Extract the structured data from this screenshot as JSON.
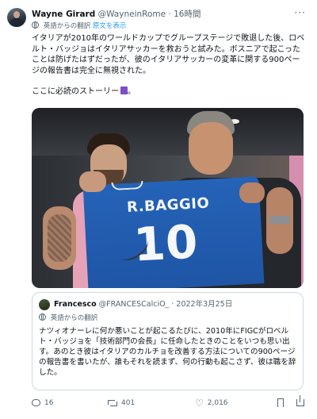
{
  "tweet": {
    "author_name": "Wayne Girard",
    "author_handle": "@WayneinRome",
    "separator": "·",
    "time": "16時間",
    "more_label": "···",
    "translated_from": "英語からの翻訳",
    "show_original": "原文を表示",
    "body_lines": [
      "イタリアが2010年のワールドカップでグループステージで敗退した後、ロベ",
      "ルト・バッジョはイタリアサッカーを救おうと試みた。ボスニアで起こった",
      "ことは防げたはずだったが、彼のイタリアサッカーの変革に関する900ペー",
      "ジの報告書は完全に無視された。"
    ],
    "body_tail": "ここに必読のストーリー",
    "body_tail_suffix": "。"
  },
  "photo": {
    "jersey_name": "R.BAGGIO",
    "jersey_number": "10"
  },
  "quote": {
    "name": "Francesco",
    "handle": "@FRANCESCalciO_",
    "separator": "·",
    "date": "2022年3月25日",
    "translated_from": "英語からの翻訳",
    "text": "ナツィオナーレに何か悪いことが起こるたびに、2010年にFIGCがロベルト・バッジョを「技術部門の会長」に任命したときのことをいつも思い出す。あのとき彼はイタリアのカルチョを改善する方法についての900ページの報告書を書いたが、誰もそれを読まず、何の行動も起こさず、彼は職を辞した。"
  },
  "actions": {
    "replies": "16",
    "retweets": "401",
    "likes": "2,016"
  },
  "icons": {
    "reply": "reply-icon",
    "retweet": "retweet-icon",
    "like": "heart-icon",
    "bookmark": "bookmark-icon",
    "share": "share-icon",
    "translate": "globe-icon",
    "book": "purple-book-emoji"
  },
  "colors": {
    "link": "#1d9bf0",
    "muted": "#536471",
    "text": "#0f1419",
    "border": "#cfd9de"
  }
}
